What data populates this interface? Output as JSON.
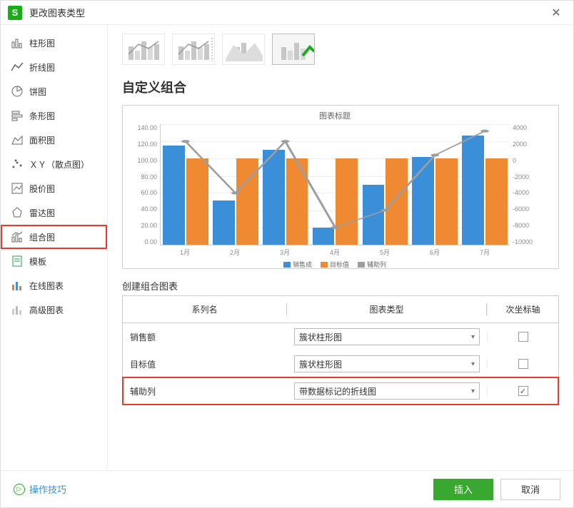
{
  "title": "更改图表类型",
  "app_icon_letter": "S",
  "sidebar": {
    "items": [
      {
        "label": "柱形图"
      },
      {
        "label": "折线图"
      },
      {
        "label": "饼图"
      },
      {
        "label": "条形图"
      },
      {
        "label": "面积图"
      },
      {
        "label": "ＸＹ（散点图）"
      },
      {
        "label": "股价图"
      },
      {
        "label": "雷达图"
      },
      {
        "label": "组合图"
      },
      {
        "label": "模板"
      },
      {
        "label": "在线图表"
      },
      {
        "label": "高级图表"
      }
    ]
  },
  "section_title": "自定义组合",
  "create_label": "创建组合图表",
  "table": {
    "headers": {
      "name": "系列名",
      "type": "图表类型",
      "axis": "次坐标轴"
    },
    "rows": [
      {
        "name": "销售额",
        "type": "簇状柱形图",
        "checked": false
      },
      {
        "name": "目标值",
        "type": "簇状柱形图",
        "checked": false
      },
      {
        "name": "辅助列",
        "type": "带数据标记的折线图",
        "checked": true
      }
    ]
  },
  "chart_data": {
    "type": "bar",
    "title": "图表标题",
    "categories": [
      "1月",
      "2月",
      "3月",
      "4月",
      "5月",
      "6月",
      "7月"
    ],
    "ylim_left": [
      0,
      140
    ],
    "yticks_left": [
      "0.00",
      "20.00",
      "40.00",
      "60.00",
      "80.00",
      "100.00",
      "120.00",
      "140.00"
    ],
    "ylim_right": [
      -10000,
      4000
    ],
    "yticks_right": [
      "4000",
      "2000",
      "0",
      "-2000",
      "-4000",
      "-6000",
      "-8000",
      "-10000"
    ],
    "series": [
      {
        "name": "销售额",
        "color": "#3a8fd8",
        "type": "bar",
        "values": [
          115,
          51,
          110,
          20,
          70,
          102,
          127
        ]
      },
      {
        "name": "目标值",
        "color": "#ef8a32",
        "type": "bar",
        "values": [
          100,
          100,
          100,
          100,
          100,
          100,
          100
        ]
      },
      {
        "name": "辅助列",
        "color": "#9e9e9e",
        "type": "line",
        "axis": "secondary",
        "values": [
          2000,
          -4000,
          2000,
          -8000,
          -6000,
          400,
          3200
        ]
      }
    ],
    "legend": [
      "销售成",
      "目标值",
      "辅助列"
    ]
  },
  "footer": {
    "help": "操作技巧",
    "insert": "插入",
    "cancel": "取消"
  }
}
